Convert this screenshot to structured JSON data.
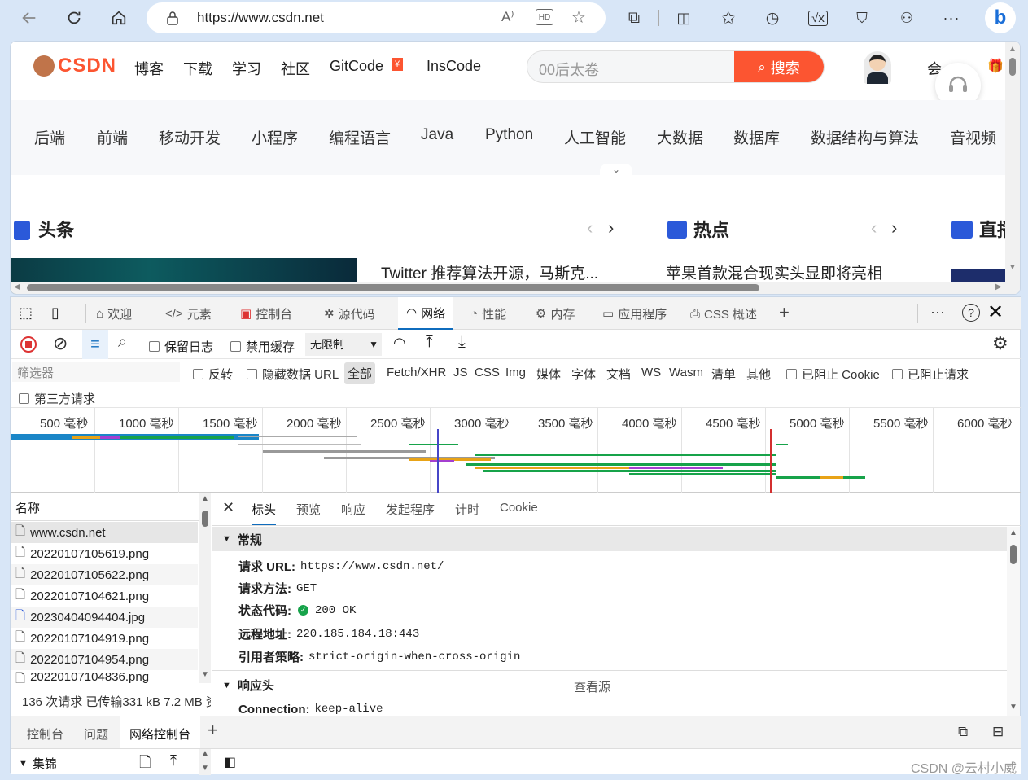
{
  "browser": {
    "url": "https://www.csdn.net"
  },
  "site": {
    "logo": "CSDN",
    "nav": [
      "博客",
      "下载",
      "学习",
      "社区",
      "GitCode",
      "InsCode"
    ],
    "search_placeholder": "00后太卷",
    "search_button": "搜索",
    "member_text": "会",
    "categories": [
      "后端",
      "前端",
      "移动开发",
      "小程序",
      "编程语言",
      "Java",
      "Python",
      "人工智能",
      "大数据",
      "数据库",
      "数据结构与算法",
      "音视频"
    ],
    "sections": {
      "headline": "头条",
      "hot": "热点",
      "live": "直播"
    },
    "headline_text": "Twitter 推荐算法开源，马斯克...",
    "hot_text": "苹果首款混合现实头显即将亮相"
  },
  "devtools": {
    "tabs": [
      "欢迎",
      "元素",
      "控制台",
      "源代码",
      "网络",
      "性能",
      "内存",
      "应用程序",
      "CSS 概述"
    ],
    "active_tab": "网络",
    "toolbar": {
      "preserve_log": "保留日志",
      "disable_cache": "禁用缓存",
      "throttle": "无限制"
    },
    "filter": {
      "placeholder": "筛选器",
      "invert": "反转",
      "hide_data_urls": "隐藏数据 URL",
      "types": [
        "全部",
        "Fetch/XHR",
        "JS",
        "CSS",
        "Img",
        "媒体",
        "字体",
        "文档",
        "WS",
        "Wasm",
        "清单",
        "其他"
      ],
      "blocked_cookies": "已阻止 Cookie",
      "blocked_requests": "已阻止请求",
      "third_party": "第三方请求"
    },
    "timeline_ticks": [
      "500 毫秒",
      "1000 毫秒",
      "1500 毫秒",
      "2000 毫秒",
      "2500 毫秒",
      "3000 毫秒",
      "3500 毫秒",
      "4000 毫秒",
      "4500 毫秒",
      "5000 毫秒",
      "5500 毫秒",
      "6000 毫秒"
    ],
    "list_header": "名称",
    "requests": [
      "www.csdn.net",
      "20220107105619.png",
      "20220107105622.png",
      "20220107104621.png",
      "20230404094404.jpg",
      "20220107104919.png",
      "20220107104954.png",
      "20220107104836.png"
    ],
    "detail_tabs": [
      "标头",
      "预览",
      "响应",
      "发起程序",
      "计时",
      "Cookie"
    ],
    "general_title": "常规",
    "general": [
      {
        "k": "请求 URL:",
        "v": "https://www.csdn.net/"
      },
      {
        "k": "请求方法:",
        "v": "GET"
      },
      {
        "k": "状态代码:",
        "v": "200 OK"
      },
      {
        "k": "远程地址:",
        "v": "220.185.184.18:443"
      },
      {
        "k": "引用者策略:",
        "v": "strict-origin-when-cross-origin"
      }
    ],
    "response_headers_title": "响应头",
    "view_source": "查看源",
    "connection": {
      "k": "Connection:",
      "v": "keep-alive"
    },
    "status_summary": "136 次请求  已传输331 kB  7.2 MB 资",
    "drawer_tabs": [
      "控制台",
      "问题",
      "网络控制台"
    ],
    "drawer_active": "网络控制台",
    "collections": "集锦"
  },
  "watermark": "CSDN @云村小威",
  "colors": {
    "brand": "#fc5531",
    "accent": "#0f6cbd",
    "status_ok": "#16a34a"
  }
}
